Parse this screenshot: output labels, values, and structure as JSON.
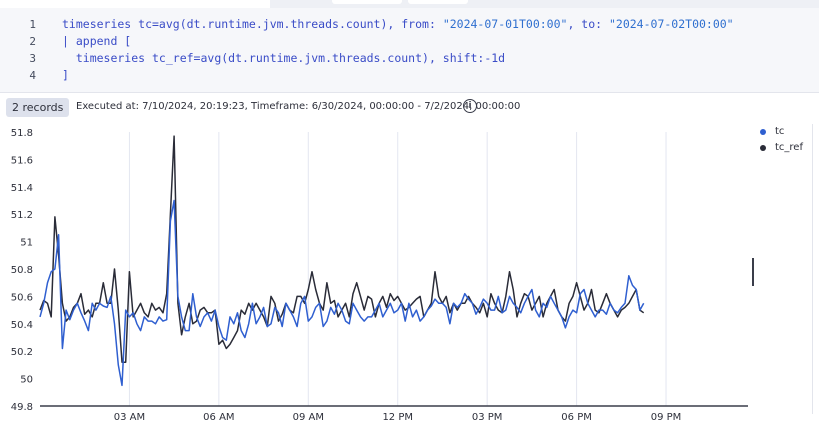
{
  "editor": {
    "line_numbers": [
      "1",
      "2",
      "3",
      "4"
    ],
    "lines": [
      [
        "timeseries tc=avg(dt.runtime.jvm.threads.count), from: ",
        "\"2024-07-01T00:00\"",
        ", to: ",
        "\"2024-07-02T00:00\""
      ],
      [
        "| append [",
        "",
        "",
        ""
      ],
      [
        "  timeseries tc_ref=avg(dt.runtime.jvm.threads.count), shift:-1d",
        "",
        "",
        ""
      ],
      [
        "]",
        "",
        "",
        ""
      ]
    ]
  },
  "status": {
    "records_label": "2 records",
    "executed_text": "Executed at: 7/10/2024, 20:19:23, Timeframe: 6/30/2024, 00:00:00 - 7/2/2024, 00:00:00",
    "info_icon": "i"
  },
  "chart_data": {
    "type": "line",
    "x_tick_labels": [
      "03 AM",
      "06 AM",
      "09 AM",
      "12 PM",
      "03 PM",
      "06 PM",
      "09 PM"
    ],
    "x_tick_hours": [
      3,
      6,
      9,
      12,
      15,
      18,
      21
    ],
    "x_range_hours": [
      0,
      23.75
    ],
    "x_step_hours": 0.125,
    "ylim": [
      49.8,
      51.8
    ],
    "y_ticks": [
      49.8,
      50,
      50.2,
      50.4,
      50.6,
      50.8,
      51,
      51.2,
      51.4,
      51.6,
      51.8
    ],
    "grid": "vertical",
    "legend_position": "top-right",
    "series": [
      {
        "name": "tc",
        "color": "#2f5fd0",
        "values": [
          50.45,
          50.55,
          50.7,
          50.78,
          50.8,
          51.05,
          50.22,
          50.5,
          50.43,
          50.5,
          50.55,
          50.48,
          50.42,
          50.35,
          50.55,
          50.5,
          50.55,
          50.53,
          50.52,
          50.6,
          50.4,
          50.1,
          49.95,
          50.5,
          50.45,
          50.48,
          50.4,
          50.35,
          50.45,
          50.42,
          50.42,
          50.4,
          50.45,
          50.42,
          50.43,
          51.15,
          51.3,
          50.6,
          50.45,
          50.35,
          50.35,
          50.62,
          50.45,
          50.38,
          50.45,
          50.48,
          50.42,
          50.5,
          50.38,
          50.3,
          50.28,
          50.45,
          50.4,
          50.48,
          50.35,
          50.3,
          50.4,
          50.55,
          50.4,
          50.45,
          50.52,
          50.38,
          50.4,
          50.52,
          50.48,
          50.38,
          50.55,
          50.5,
          50.45,
          50.38,
          50.55,
          50.6,
          50.42,
          50.45,
          50.52,
          50.55,
          50.38,
          50.42,
          50.52,
          50.47,
          50.55,
          50.5,
          50.42,
          50.4,
          50.55,
          50.5,
          50.45,
          50.42,
          50.45,
          50.45,
          50.5,
          50.55,
          50.45,
          50.5,
          50.55,
          50.48,
          50.5,
          50.55,
          50.42,
          50.55,
          50.45,
          50.5,
          50.42,
          50.45,
          50.5,
          50.53,
          50.58,
          50.55,
          50.55,
          50.52,
          50.4,
          50.55,
          50.52,
          50.55,
          50.62,
          50.58,
          50.55,
          50.47,
          50.52,
          50.58,
          50.55,
          50.5,
          50.5,
          50.6,
          50.48,
          50.5,
          50.6,
          50.55,
          50.52,
          50.48,
          50.55,
          50.6,
          50.65,
          50.5,
          50.45,
          50.55,
          50.52,
          50.6,
          50.55,
          50.5,
          50.45,
          50.37,
          50.45,
          50.5,
          50.48,
          50.62,
          50.65,
          50.55,
          50.5,
          50.45,
          50.5,
          50.5,
          50.47,
          50.55,
          50.5,
          50.48,
          50.52,
          50.55,
          50.75,
          50.68,
          50.65,
          50.5,
          50.55
        ]
      },
      {
        "name": "tc_ref",
        "color": "#2a2c38",
        "values": [
          50.5,
          50.57,
          50.55,
          50.45,
          51.18,
          50.9,
          50.55,
          50.42,
          50.45,
          50.52,
          50.55,
          50.62,
          50.47,
          50.5,
          50.45,
          50.55,
          50.55,
          50.7,
          50.55,
          50.55,
          50.8,
          50.5,
          50.12,
          50.12,
          50.78,
          50.45,
          50.5,
          50.55,
          50.48,
          50.45,
          50.55,
          50.5,
          50.52,
          50.48,
          50.62,
          51.2,
          51.77,
          50.55,
          50.32,
          50.45,
          50.55,
          50.4,
          50.42,
          50.5,
          50.52,
          50.48,
          50.48,
          50.5,
          50.25,
          50.28,
          50.22,
          50.25,
          50.3,
          50.35,
          50.5,
          50.47,
          50.55,
          50.5,
          50.55,
          50.5,
          50.45,
          50.38,
          50.6,
          50.55,
          50.42,
          50.47,
          50.55,
          50.5,
          50.48,
          50.6,
          50.6,
          50.55,
          50.65,
          50.78,
          50.65,
          50.55,
          50.5,
          50.7,
          50.55,
          50.57,
          50.45,
          50.5,
          50.55,
          50.45,
          50.62,
          50.7,
          50.6,
          50.5,
          50.6,
          50.58,
          50.45,
          50.55,
          50.6,
          50.52,
          50.62,
          50.57,
          50.6,
          50.55,
          50.5,
          50.52,
          50.55,
          50.58,
          50.6,
          50.45,
          50.5,
          50.55,
          50.78,
          50.6,
          50.55,
          50.6,
          50.48,
          50.55,
          50.5,
          50.55,
          50.55,
          50.6,
          50.55,
          50.52,
          50.48,
          50.55,
          50.45,
          50.62,
          50.55,
          50.5,
          50.48,
          50.6,
          50.78,
          50.65,
          50.45,
          50.55,
          50.62,
          50.6,
          50.5,
          50.55,
          50.6,
          50.45,
          50.55,
          50.6,
          50.65,
          50.5,
          50.45,
          50.42,
          50.55,
          50.6,
          50.7,
          50.6,
          50.5,
          50.55,
          50.65,
          50.5,
          50.48,
          50.55,
          50.62,
          50.55,
          50.5,
          50.45,
          50.5,
          50.52,
          50.55,
          50.6,
          50.65,
          50.5,
          50.48
        ]
      }
    ]
  }
}
